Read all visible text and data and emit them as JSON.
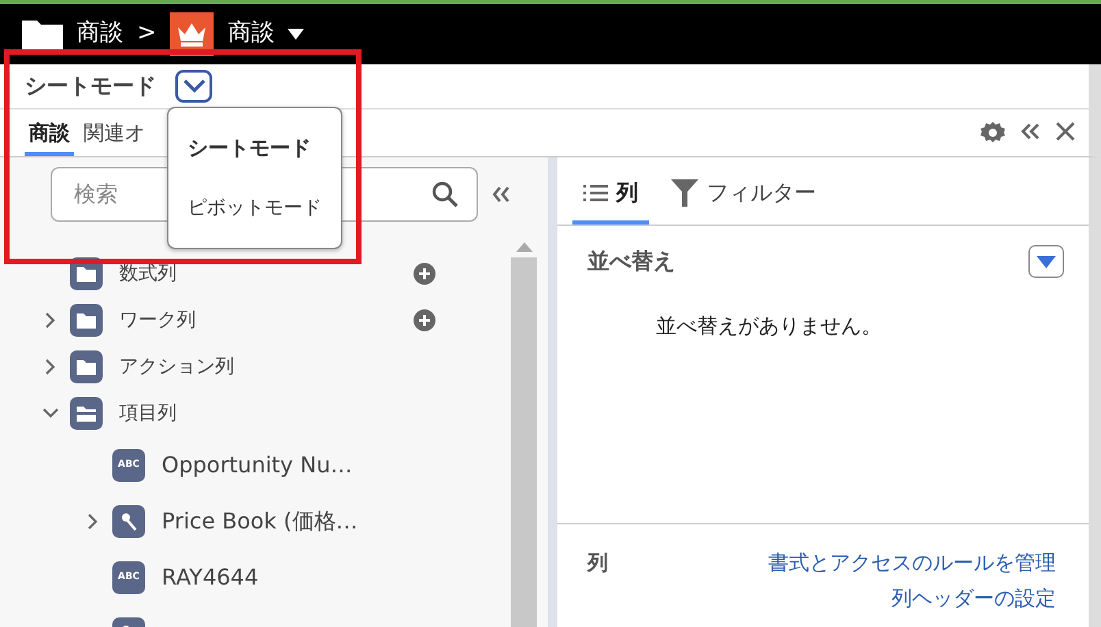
{
  "breadcrumb": {
    "root_label": "商談",
    "separator": ">",
    "object_label": "商談"
  },
  "mode_selector": {
    "label": "シートモード"
  },
  "mode_menu": [
    {
      "label": "シートモード",
      "selected": true
    },
    {
      "label": "ピボットモード",
      "selected": false
    }
  ],
  "tabs": [
    {
      "label": "商談",
      "selected": true
    },
    {
      "label": "関連オ",
      "selected": false
    }
  ],
  "search": {
    "placeholder": "検索"
  },
  "tree": [
    {
      "label": "数式列",
      "kind": "folder",
      "addable": true
    },
    {
      "label": "ワーク列",
      "kind": "folder",
      "expanded": false,
      "addable": true
    },
    {
      "label": "アクション列",
      "kind": "folder",
      "expanded": false,
      "addable": false
    },
    {
      "label": "項目列",
      "kind": "folder",
      "expanded": true,
      "addable": false,
      "children": [
        {
          "label": "Opportunity Nu…",
          "kind": "text",
          "icon_label": "ABC"
        },
        {
          "label": "Price Book (価格…",
          "kind": "lookup",
          "expanded": false
        },
        {
          "label": "RAY4644",
          "kind": "text",
          "icon_label": "ABC"
        },
        {
          "kind": "lookup"
        }
      ]
    }
  ],
  "panel_tabs": [
    {
      "label": "列",
      "kind": "list",
      "selected": true
    },
    {
      "label": "フィルター",
      "kind": "filter",
      "selected": false
    }
  ],
  "sort_section": {
    "title": "並べ替え",
    "empty_message": "並べ替えがありません。"
  },
  "columns_section": {
    "title": "列",
    "links": [
      "書式とアクセスのルールを管理",
      "列ヘッダーの設定"
    ]
  }
}
